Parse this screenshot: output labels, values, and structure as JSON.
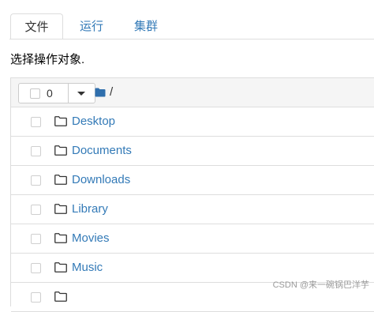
{
  "tabs": [
    {
      "label": "文件"
    },
    {
      "label": "运行"
    },
    {
      "label": "集群"
    }
  ],
  "prompt": "选择操作对象.",
  "toolbar": {
    "selected_count": "0",
    "breadcrumb": "/"
  },
  "files": [
    {
      "name": "Desktop",
      "icon": "folder-icon"
    },
    {
      "name": "Documents",
      "icon": "folder-icon"
    },
    {
      "name": "Downloads",
      "icon": "folder-icon"
    },
    {
      "name": "Library",
      "icon": "folder-icon"
    },
    {
      "name": "Movies",
      "icon": "folder-icon"
    },
    {
      "name": "Music",
      "icon": "folder-icon"
    },
    {
      "name": "",
      "icon": "folder-icon"
    }
  ],
  "watermark": "CSDN @来一碗锅巴洋芋",
  "colors": {
    "link": "#337ab7",
    "folder_header": "#2f6fad",
    "border": "#dddddd",
    "header_bg": "#f5f5f5"
  }
}
